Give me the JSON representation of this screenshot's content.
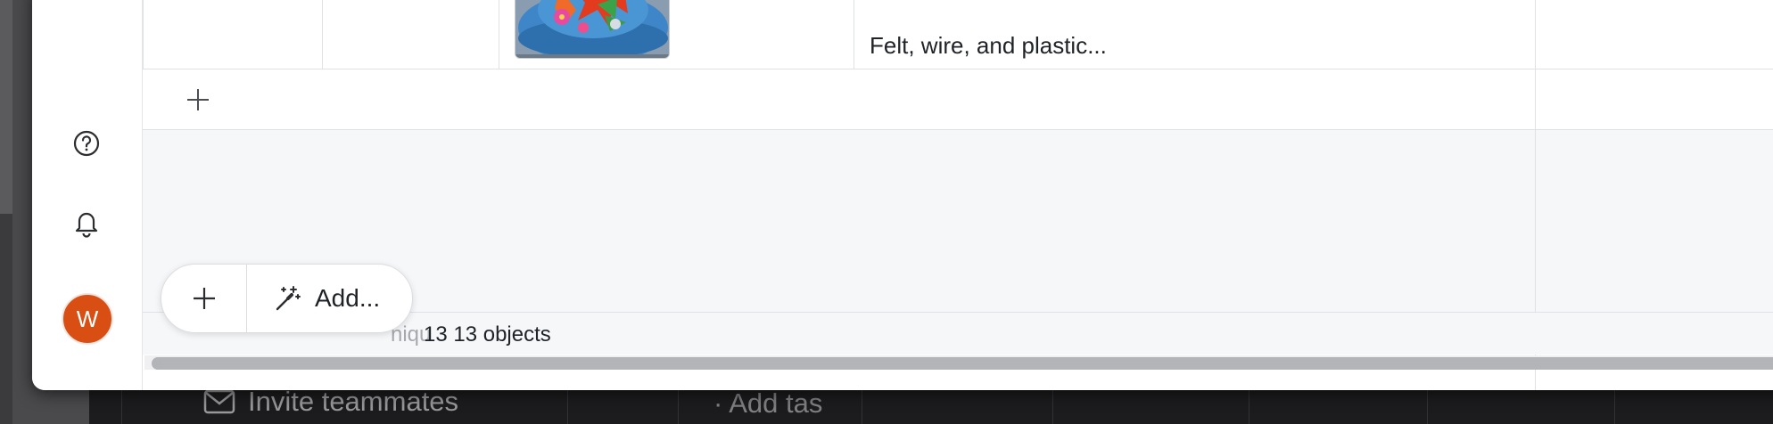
{
  "background_app": {
    "invite_label": "Invite teammates",
    "add_task_label": "· Add tas"
  },
  "sidebar": {
    "help_icon": "question-circle-icon",
    "notifications_icon": "bell-icon",
    "avatar_initial": "W",
    "avatar_color": "#d94e12"
  },
  "table": {
    "last_row": {
      "image_icon": "thumbnail-image",
      "description": "Felt, wire, and plastic..."
    },
    "add_row_icon": "plus-icon",
    "footer": {
      "ghost_text": "niqu",
      "count_text": "13 13 objects"
    }
  },
  "toolbar": {
    "plus_icon": "plus-icon",
    "add_label": "Add...",
    "add_icon": "magic-wand-icon"
  }
}
